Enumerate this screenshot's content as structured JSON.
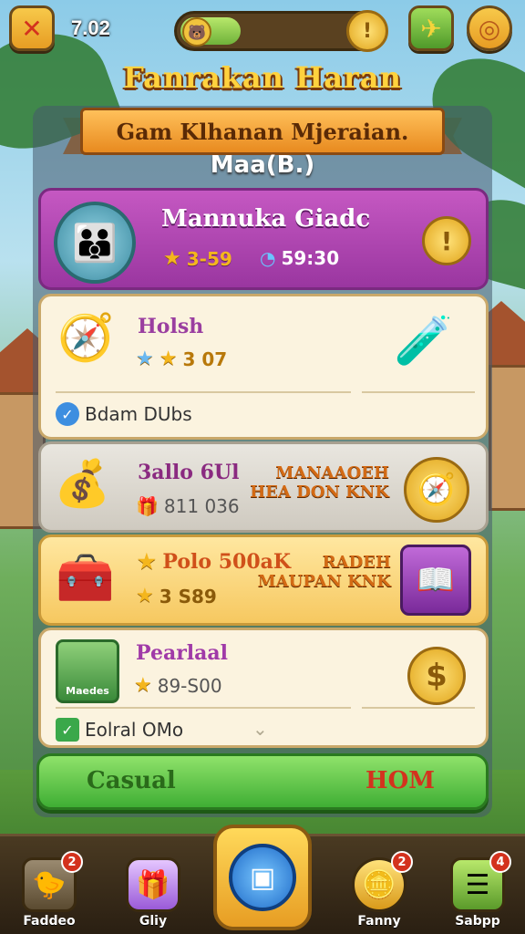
{
  "top_bar": {
    "score": "7.02",
    "close_icon": "close-icon",
    "coin_symbol": "!",
    "map_icon": "map-icon",
    "settings_icon": "settings-icon"
  },
  "header": {
    "title": "Fanrakan Haran",
    "ribbon": "Gam Klhanan Mjeraian.",
    "subtitle": "Maa(B.)"
  },
  "cards": [
    {
      "title": "Mannuka Giadc",
      "stat1": "3-59",
      "stat2": "59:30"
    },
    {
      "title": "Holsh",
      "stat1": "3 07",
      "footer": "Bdam DUbs"
    },
    {
      "title": "3allo 6Ul",
      "stat1": "811 036",
      "promo_line1": "MANAAOEH",
      "promo_line2": "HEA DON KNK"
    },
    {
      "title": "Polo 500aK",
      "stat1": "3 S89",
      "promo_line1": "RADEH",
      "promo_line2": "MAUPAN KNK"
    },
    {
      "title": "Pearlaal",
      "stat1": "89-S00",
      "chest_label": "Maedes",
      "footer": "Eolral OMo"
    }
  ],
  "cta": {
    "left_label": "Casual",
    "right_label": "HOM"
  },
  "nav": [
    {
      "label": "Faddeo",
      "badge": "2",
      "icon": "bird-icon"
    },
    {
      "label": "Gliy",
      "badge": "",
      "icon": "gift-cube-icon"
    },
    {
      "label": "",
      "badge": "",
      "icon": "play-center-icon"
    },
    {
      "label": "Fanny",
      "badge": "2",
      "icon": "coin-stack-icon"
    },
    {
      "label": "Sabpp",
      "badge": "4",
      "icon": "menu-icon"
    }
  ]
}
